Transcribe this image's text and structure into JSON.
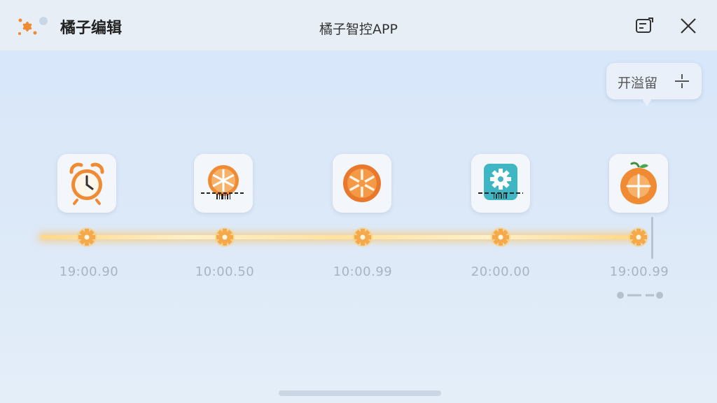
{
  "header": {
    "app_name": "橘子编辑",
    "window_title": "橘子智控APP",
    "logo_icon": "orange-flower-logo-icon",
    "export_icon": "export-icon",
    "close_icon": "close-icon"
  },
  "tooltip": {
    "label": "开溢留",
    "icon": "split-icon"
  },
  "timeline": {
    "steps": [
      {
        "icon": "alarm-clock-icon",
        "time": "19:00.90"
      },
      {
        "icon": "orange-slice-barcode-icon",
        "time": "10:00.50"
      },
      {
        "icon": "orange-slice-icon",
        "time": "10:00.99"
      },
      {
        "icon": "settings-gear-barcode-icon",
        "time": "20:00.00"
      },
      {
        "icon": "orange-fruit-icon",
        "time": "19:00.99"
      }
    ],
    "node_icon": "gear-icon"
  },
  "colors": {
    "accent_orange": "#f08a33",
    "timeline_glow": "#ffcf73",
    "teal": "#3fb6c4",
    "time_text": "#a9b4c2"
  }
}
